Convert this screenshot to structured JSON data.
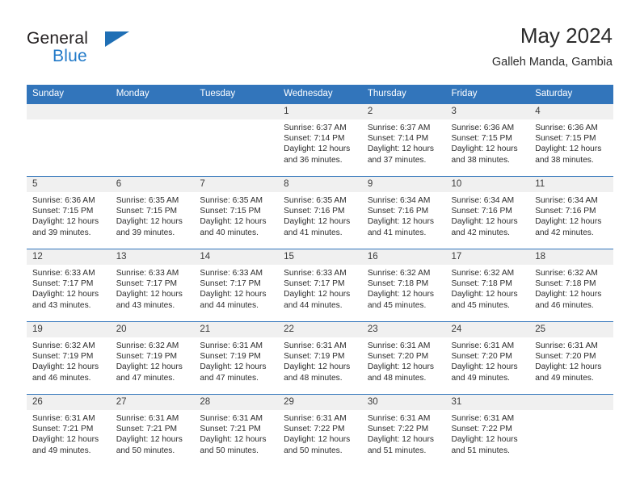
{
  "branding": {
    "logo_primary": "General",
    "logo_secondary": "Blue",
    "logo_icon": "triangle-icon"
  },
  "header": {
    "title": "May 2024",
    "subtitle": "Galleh Manda, Gambia"
  },
  "colors": {
    "header_blue": "#3275bb",
    "logo_blue": "#2079c8",
    "daynum_band": "#f0f0f0",
    "text": "#2c2c2c"
  },
  "calendar": {
    "weekday_headers": [
      "Sunday",
      "Monday",
      "Tuesday",
      "Wednesday",
      "Thursday",
      "Friday",
      "Saturday"
    ],
    "weeks": [
      [
        {
          "day": "",
          "empty": true,
          "sunrise": "",
          "sunset": "",
          "daylight1": "",
          "daylight2": ""
        },
        {
          "day": "",
          "empty": true,
          "sunrise": "",
          "sunset": "",
          "daylight1": "",
          "daylight2": ""
        },
        {
          "day": "",
          "empty": true,
          "sunrise": "",
          "sunset": "",
          "daylight1": "",
          "daylight2": ""
        },
        {
          "day": "1",
          "sunrise": "Sunrise: 6:37 AM",
          "sunset": "Sunset: 7:14 PM",
          "daylight1": "Daylight: 12 hours",
          "daylight2": "and 36 minutes."
        },
        {
          "day": "2",
          "sunrise": "Sunrise: 6:37 AM",
          "sunset": "Sunset: 7:14 PM",
          "daylight1": "Daylight: 12 hours",
          "daylight2": "and 37 minutes."
        },
        {
          "day": "3",
          "sunrise": "Sunrise: 6:36 AM",
          "sunset": "Sunset: 7:15 PM",
          "daylight1": "Daylight: 12 hours",
          "daylight2": "and 38 minutes."
        },
        {
          "day": "4",
          "sunrise": "Sunrise: 6:36 AM",
          "sunset": "Sunset: 7:15 PM",
          "daylight1": "Daylight: 12 hours",
          "daylight2": "and 38 minutes."
        }
      ],
      [
        {
          "day": "5",
          "sunrise": "Sunrise: 6:36 AM",
          "sunset": "Sunset: 7:15 PM",
          "daylight1": "Daylight: 12 hours",
          "daylight2": "and 39 minutes."
        },
        {
          "day": "6",
          "sunrise": "Sunrise: 6:35 AM",
          "sunset": "Sunset: 7:15 PM",
          "daylight1": "Daylight: 12 hours",
          "daylight2": "and 39 minutes."
        },
        {
          "day": "7",
          "sunrise": "Sunrise: 6:35 AM",
          "sunset": "Sunset: 7:15 PM",
          "daylight1": "Daylight: 12 hours",
          "daylight2": "and 40 minutes."
        },
        {
          "day": "8",
          "sunrise": "Sunrise: 6:35 AM",
          "sunset": "Sunset: 7:16 PM",
          "daylight1": "Daylight: 12 hours",
          "daylight2": "and 41 minutes."
        },
        {
          "day": "9",
          "sunrise": "Sunrise: 6:34 AM",
          "sunset": "Sunset: 7:16 PM",
          "daylight1": "Daylight: 12 hours",
          "daylight2": "and 41 minutes."
        },
        {
          "day": "10",
          "sunrise": "Sunrise: 6:34 AM",
          "sunset": "Sunset: 7:16 PM",
          "daylight1": "Daylight: 12 hours",
          "daylight2": "and 42 minutes."
        },
        {
          "day": "11",
          "sunrise": "Sunrise: 6:34 AM",
          "sunset": "Sunset: 7:16 PM",
          "daylight1": "Daylight: 12 hours",
          "daylight2": "and 42 minutes."
        }
      ],
      [
        {
          "day": "12",
          "sunrise": "Sunrise: 6:33 AM",
          "sunset": "Sunset: 7:17 PM",
          "daylight1": "Daylight: 12 hours",
          "daylight2": "and 43 minutes."
        },
        {
          "day": "13",
          "sunrise": "Sunrise: 6:33 AM",
          "sunset": "Sunset: 7:17 PM",
          "daylight1": "Daylight: 12 hours",
          "daylight2": "and 43 minutes."
        },
        {
          "day": "14",
          "sunrise": "Sunrise: 6:33 AM",
          "sunset": "Sunset: 7:17 PM",
          "daylight1": "Daylight: 12 hours",
          "daylight2": "and 44 minutes."
        },
        {
          "day": "15",
          "sunrise": "Sunrise: 6:33 AM",
          "sunset": "Sunset: 7:17 PM",
          "daylight1": "Daylight: 12 hours",
          "daylight2": "and 44 minutes."
        },
        {
          "day": "16",
          "sunrise": "Sunrise: 6:32 AM",
          "sunset": "Sunset: 7:18 PM",
          "daylight1": "Daylight: 12 hours",
          "daylight2": "and 45 minutes."
        },
        {
          "day": "17",
          "sunrise": "Sunrise: 6:32 AM",
          "sunset": "Sunset: 7:18 PM",
          "daylight1": "Daylight: 12 hours",
          "daylight2": "and 45 minutes."
        },
        {
          "day": "18",
          "sunrise": "Sunrise: 6:32 AM",
          "sunset": "Sunset: 7:18 PM",
          "daylight1": "Daylight: 12 hours",
          "daylight2": "and 46 minutes."
        }
      ],
      [
        {
          "day": "19",
          "sunrise": "Sunrise: 6:32 AM",
          "sunset": "Sunset: 7:19 PM",
          "daylight1": "Daylight: 12 hours",
          "daylight2": "and 46 minutes."
        },
        {
          "day": "20",
          "sunrise": "Sunrise: 6:32 AM",
          "sunset": "Sunset: 7:19 PM",
          "daylight1": "Daylight: 12 hours",
          "daylight2": "and 47 minutes."
        },
        {
          "day": "21",
          "sunrise": "Sunrise: 6:31 AM",
          "sunset": "Sunset: 7:19 PM",
          "daylight1": "Daylight: 12 hours",
          "daylight2": "and 47 minutes."
        },
        {
          "day": "22",
          "sunrise": "Sunrise: 6:31 AM",
          "sunset": "Sunset: 7:19 PM",
          "daylight1": "Daylight: 12 hours",
          "daylight2": "and 48 minutes."
        },
        {
          "day": "23",
          "sunrise": "Sunrise: 6:31 AM",
          "sunset": "Sunset: 7:20 PM",
          "daylight1": "Daylight: 12 hours",
          "daylight2": "and 48 minutes."
        },
        {
          "day": "24",
          "sunrise": "Sunrise: 6:31 AM",
          "sunset": "Sunset: 7:20 PM",
          "daylight1": "Daylight: 12 hours",
          "daylight2": "and 49 minutes."
        },
        {
          "day": "25",
          "sunrise": "Sunrise: 6:31 AM",
          "sunset": "Sunset: 7:20 PM",
          "daylight1": "Daylight: 12 hours",
          "daylight2": "and 49 minutes."
        }
      ],
      [
        {
          "day": "26",
          "sunrise": "Sunrise: 6:31 AM",
          "sunset": "Sunset: 7:21 PM",
          "daylight1": "Daylight: 12 hours",
          "daylight2": "and 49 minutes."
        },
        {
          "day": "27",
          "sunrise": "Sunrise: 6:31 AM",
          "sunset": "Sunset: 7:21 PM",
          "daylight1": "Daylight: 12 hours",
          "daylight2": "and 50 minutes."
        },
        {
          "day": "28",
          "sunrise": "Sunrise: 6:31 AM",
          "sunset": "Sunset: 7:21 PM",
          "daylight1": "Daylight: 12 hours",
          "daylight2": "and 50 minutes."
        },
        {
          "day": "29",
          "sunrise": "Sunrise: 6:31 AM",
          "sunset": "Sunset: 7:22 PM",
          "daylight1": "Daylight: 12 hours",
          "daylight2": "and 50 minutes."
        },
        {
          "day": "30",
          "sunrise": "Sunrise: 6:31 AM",
          "sunset": "Sunset: 7:22 PM",
          "daylight1": "Daylight: 12 hours",
          "daylight2": "and 51 minutes."
        },
        {
          "day": "31",
          "sunrise": "Sunrise: 6:31 AM",
          "sunset": "Sunset: 7:22 PM",
          "daylight1": "Daylight: 12 hours",
          "daylight2": "and 51 minutes."
        },
        {
          "day": "",
          "empty": true,
          "sunrise": "",
          "sunset": "",
          "daylight1": "",
          "daylight2": ""
        }
      ]
    ]
  }
}
